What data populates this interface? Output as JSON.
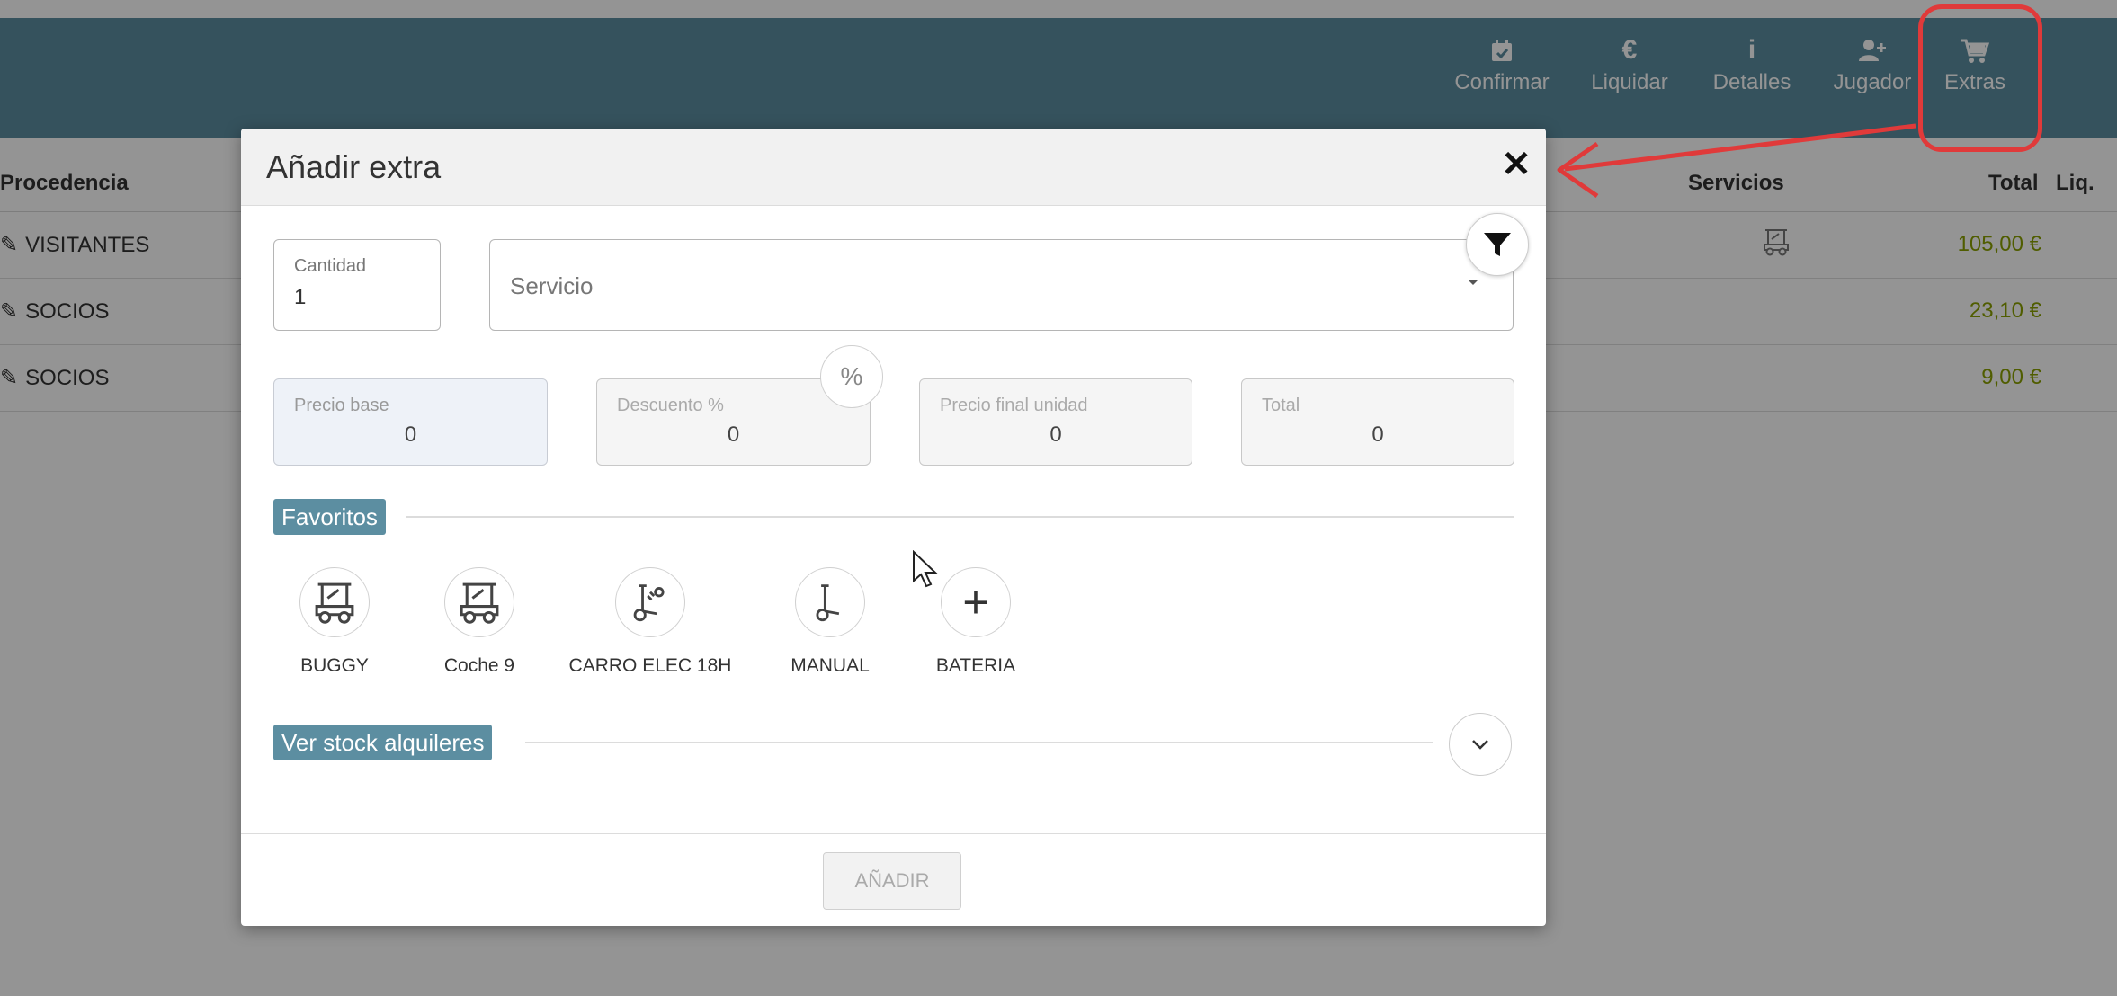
{
  "toolbar": {
    "confirm_label": "Confirmar",
    "settle_label": "Liquidar",
    "details_label": "Detalles",
    "player_label": "Jugador",
    "extras_label": "Extras",
    "settle_glyph": "€",
    "details_glyph": "i"
  },
  "table": {
    "headers": {
      "origin": "Procedencia",
      "services": "Servicios",
      "total": "Total",
      "settled": "Liq."
    },
    "rows": [
      {
        "origin": "VISITANTES",
        "total": "105,00 €",
        "has_buggy": true
      },
      {
        "origin": "SOCIOS",
        "total": "23,10 €",
        "has_buggy": false
      },
      {
        "origin": "SOCIOS",
        "total": "9,00 €",
        "has_buggy": false
      }
    ]
  },
  "modal": {
    "title": "Añadir extra",
    "close_glyph": "✕",
    "quantity": {
      "label": "Cantidad",
      "value": "1"
    },
    "service": {
      "placeholder": "Servicio"
    },
    "percent_glyph": "%",
    "price_base": {
      "label": "Precio base",
      "value": "0"
    },
    "discount": {
      "label": "Descuento %",
      "value": "0"
    },
    "final_unit_price": {
      "label": "Precio final unidad",
      "value": "0"
    },
    "total": {
      "label": "Total",
      "value": "0"
    },
    "favorites_title": "Favoritos",
    "favorites": [
      {
        "label": "BUGGY",
        "icon": "golf-cart-icon"
      },
      {
        "label": "Coche 9",
        "icon": "golf-cart-icon"
      },
      {
        "label": "CARRO ELEC 18H",
        "icon": "electric-trolley-icon"
      },
      {
        "label": "MANUAL",
        "icon": "manual-trolley-icon"
      },
      {
        "label": "BATERIA",
        "icon": "plus-icon"
      }
    ],
    "plus_glyph": "+",
    "stock_title": "Ver stock alquileres",
    "add_button": "AÑADIR"
  },
  "colors": {
    "topbar": "#5c8ea1",
    "accent_tag": "#5c8ea1",
    "amount": "#8aa000",
    "highlight": "#e03a3a"
  }
}
